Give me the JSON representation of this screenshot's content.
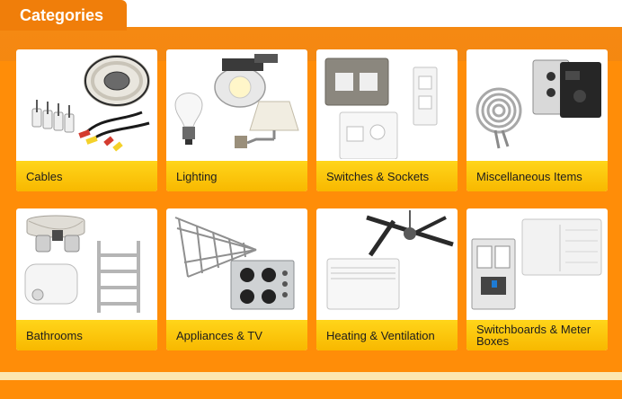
{
  "header": {
    "title": "Categories"
  },
  "categories": [
    {
      "label": "Cables"
    },
    {
      "label": "Lighting"
    },
    {
      "label": "Switches & Sockets"
    },
    {
      "label": "Miscellaneous Items"
    },
    {
      "label": "Bathrooms"
    },
    {
      "label": "Appliances & TV"
    },
    {
      "label": "Heating & Ventilation"
    },
    {
      "label": "Switchboards & Meter Boxes"
    }
  ],
  "colors": {
    "frame": "#f07e0a",
    "label_bar": "#ffd51a",
    "card": "#ffffff"
  }
}
